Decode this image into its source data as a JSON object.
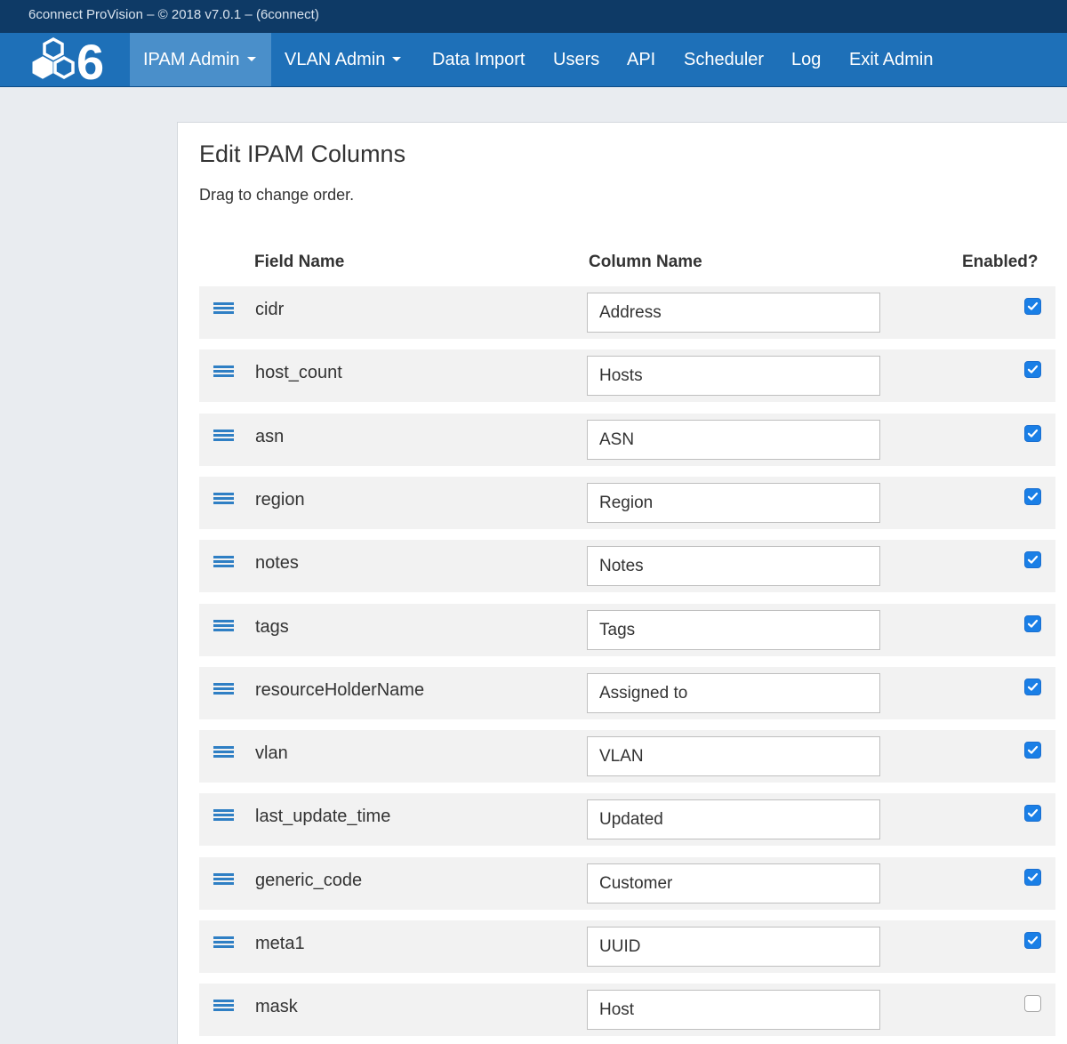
{
  "window": {
    "title": "6connect ProVision – © 2018 v7.0.1 – (6connect)"
  },
  "nav": {
    "logo_digit": "6",
    "items": [
      {
        "label": "IPAM Admin",
        "dropdown": true,
        "active": true
      },
      {
        "label": "VLAN Admin",
        "dropdown": true,
        "active": false
      },
      {
        "label": "Data Import",
        "dropdown": false,
        "active": false
      },
      {
        "label": "Users",
        "dropdown": false,
        "active": false
      },
      {
        "label": "API",
        "dropdown": false,
        "active": false
      },
      {
        "label": "Scheduler",
        "dropdown": false,
        "active": false
      },
      {
        "label": "Log",
        "dropdown": false,
        "active": false
      },
      {
        "label": "Exit Admin",
        "dropdown": false,
        "active": false
      }
    ]
  },
  "page": {
    "title": "Edit IPAM Columns",
    "hint": "Drag to change order."
  },
  "table": {
    "headers": {
      "field": "Field Name",
      "column": "Column Name",
      "enabled": "Enabled?"
    },
    "rows": [
      {
        "field": "cidr",
        "column": "Address",
        "enabled": true
      },
      {
        "field": "host_count",
        "column": "Hosts",
        "enabled": true
      },
      {
        "field": "asn",
        "column": "ASN",
        "enabled": true
      },
      {
        "field": "region",
        "column": "Region",
        "enabled": true
      },
      {
        "field": "notes",
        "column": "Notes",
        "enabled": true
      },
      {
        "field": "tags",
        "column": "Tags",
        "enabled": true
      },
      {
        "field": "resourceHolderName",
        "column": "Assigned to",
        "enabled": true
      },
      {
        "field": "vlan",
        "column": "VLAN",
        "enabled": true
      },
      {
        "field": "last_update_time",
        "column": "Updated",
        "enabled": true
      },
      {
        "field": "generic_code",
        "column": "Customer",
        "enabled": true
      },
      {
        "field": "meta1",
        "column": "UUID",
        "enabled": true
      },
      {
        "field": "mask",
        "column": "Host",
        "enabled": false
      }
    ]
  },
  "colors": {
    "titlebar": "#0e3a66",
    "navbar": "#1e70b8",
    "nav_active": "#4a8fca",
    "checkbox_on": "#1a7fe6",
    "drag_handle": "#2f7fc4"
  }
}
